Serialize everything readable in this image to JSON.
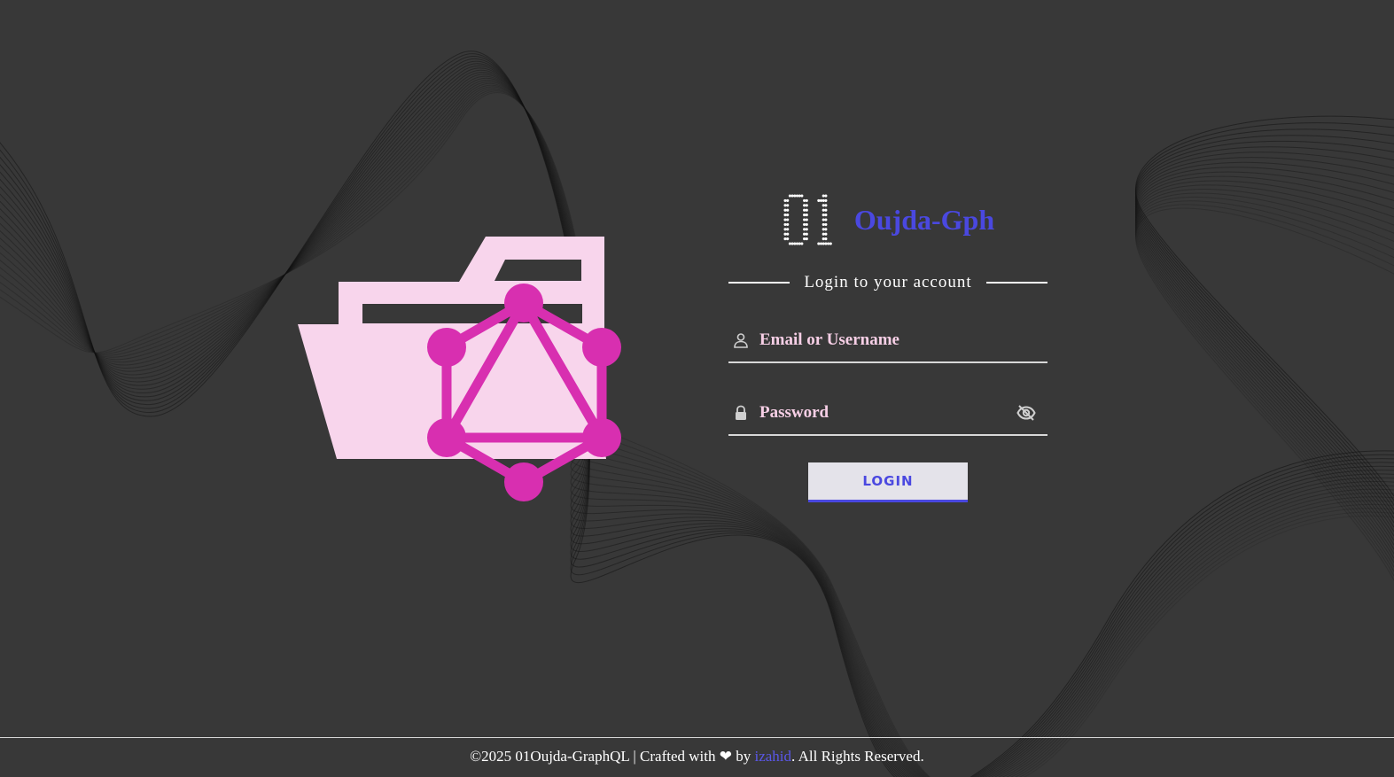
{
  "brand": {
    "logo_text": "01",
    "name": "Oujda-Gph",
    "color": "#4a48e0"
  },
  "login": {
    "subtitle": "Login to your account",
    "username_placeholder": "Email or Username",
    "username_icon": "user-icon",
    "password_placeholder": "Password",
    "password_icon": "lock-icon",
    "toggle_icon": "eye-off-icon",
    "button_label": "LOGIN"
  },
  "hero": {
    "icon": "graphql-folder-icon",
    "folder_color": "#f8d5ec",
    "graphql_color": "#d82fb0"
  },
  "footer": {
    "prefix": "©2025 01Oujda-GraphQL | Crafted with ❤ by ",
    "author": "izahid",
    "suffix": ". All Rights Reserved."
  },
  "colors": {
    "background": "#383838",
    "accent": "#4a48e0",
    "input_text": "#f7cfe6"
  }
}
